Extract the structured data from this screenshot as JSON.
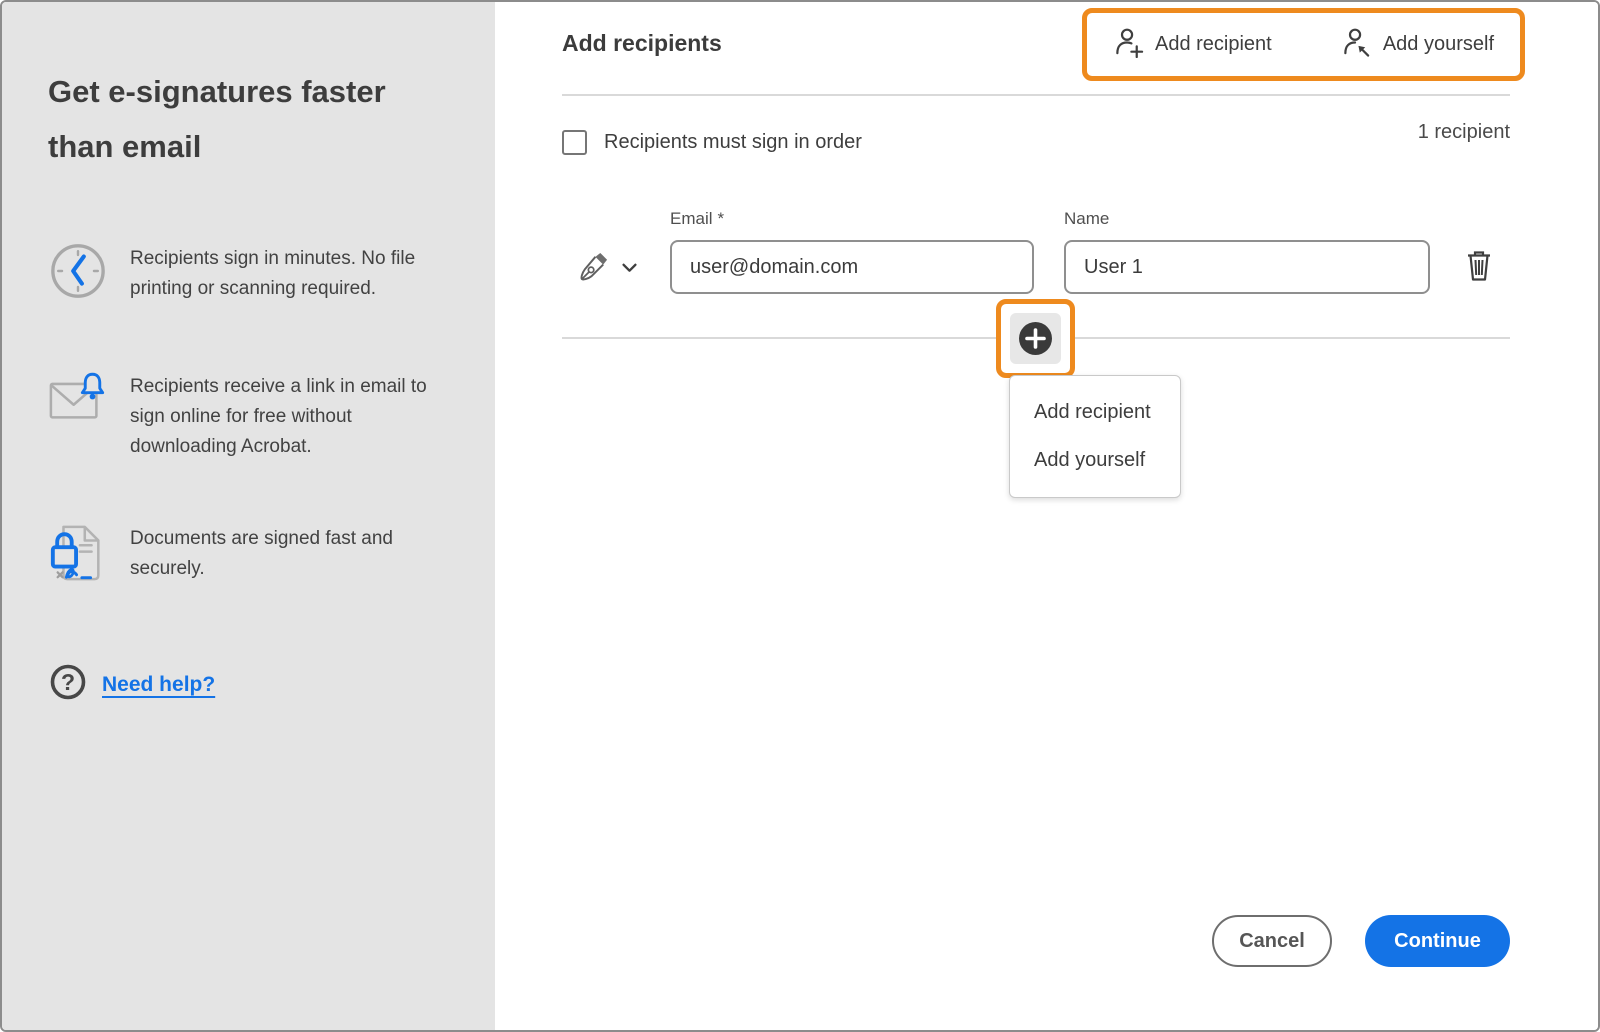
{
  "sidebar": {
    "heading_line1": "Get e-signatures faster",
    "heading_line2": "than email",
    "benefits": [
      {
        "icon": "clock-icon",
        "text": "Recipients sign in minutes. No file printing or scanning required."
      },
      {
        "icon": "email-notification-icon",
        "text": "Recipients receive a link in email to sign online for free without downloading Acrobat."
      },
      {
        "icon": "secure-document-icon",
        "text": "Documents are signed fast and securely."
      }
    ],
    "help": {
      "icon": "question-circle-icon",
      "label": "Need help?"
    }
  },
  "main": {
    "title": "Add recipients",
    "toolbar": {
      "add_recipient": {
        "icon": "person-plus-icon",
        "label": "Add recipient"
      },
      "add_yourself": {
        "icon": "person-self-icon",
        "label": "Add yourself"
      }
    },
    "order_checkbox": {
      "label": "Recipients must sign in order",
      "checked": false
    },
    "recipient_count": "1 recipient",
    "recipient_row": {
      "role_icon": "pen-nib-icon",
      "email_label": "Email",
      "required_marker": "*",
      "email_value": "user@domain.com",
      "name_label": "Name",
      "name_value": "User 1",
      "delete_icon": "trash-icon"
    },
    "add_button_icon": "plus-circle-icon",
    "add_menu_items": [
      "Add recipient",
      "Add yourself"
    ],
    "footer": {
      "cancel_label": "Cancel",
      "continue_label": "Continue"
    }
  },
  "colors": {
    "accent_orange": "#EE8A1E",
    "primary_blue": "#1473E6",
    "sidebar_background": "#E4E4E4"
  }
}
